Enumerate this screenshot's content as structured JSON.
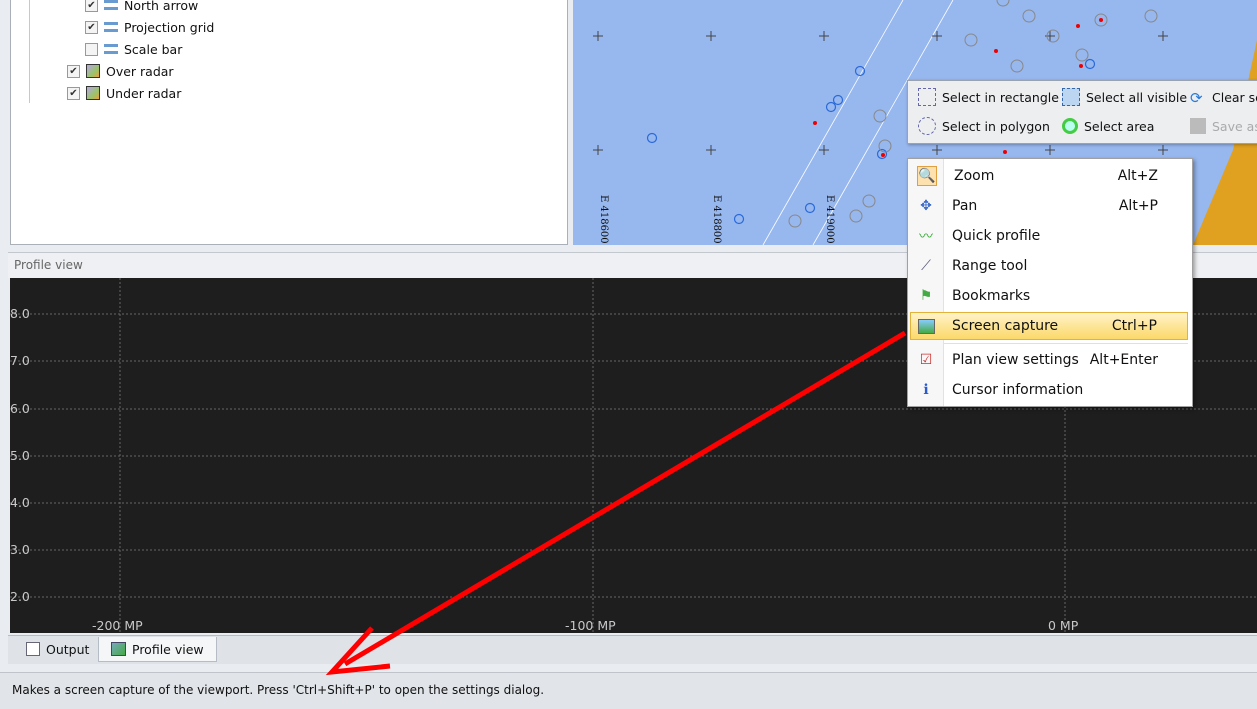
{
  "tree": {
    "items": [
      {
        "label": "North arrow",
        "checked": true
      },
      {
        "label": "Projection grid",
        "checked": true
      },
      {
        "label": "Scale bar",
        "checked": false
      },
      {
        "label": "Over radar",
        "checked": true
      },
      {
        "label": "Under radar",
        "checked": true
      }
    ]
  },
  "map": {
    "grid_labels": [
      "E 418600",
      "E 418800",
      "E 419000"
    ]
  },
  "selection_toolbar": {
    "select_rectangle": "Select in rectangle",
    "select_all_visible": "Select all visible",
    "clear_selection": "Clear se",
    "select_polygon": "Select in polygon",
    "select_area": "Select area",
    "save_as": "Save as"
  },
  "context_menu": {
    "items": [
      {
        "label": "Zoom",
        "shortcut": "Alt+Z"
      },
      {
        "label": "Pan",
        "shortcut": "Alt+P"
      },
      {
        "label": "Quick profile",
        "shortcut": ""
      },
      {
        "label": "Range tool",
        "shortcut": ""
      },
      {
        "label": "Bookmarks",
        "shortcut": ""
      },
      {
        "label": "Screen capture",
        "shortcut": "Ctrl+P"
      },
      {
        "label": "Plan view settings",
        "shortcut": "Alt+Enter"
      },
      {
        "label": "Cursor information",
        "shortcut": ""
      }
    ]
  },
  "profile": {
    "title": "Profile view",
    "y_ticks": [
      "8.0",
      "7.0",
      "6.0",
      "5.0",
      "4.0",
      "3.0",
      "2.0"
    ],
    "x_ticks": [
      "-200 MP",
      "-100 MP",
      "0 MP"
    ]
  },
  "tabs": {
    "output": "Output",
    "profile_view": "Profile view"
  },
  "status": "Makes a screen capture of the viewport. Press 'Ctrl+Shift+P' to open the settings dialog.",
  "colors": {
    "map_bg": "#97b7ef",
    "plot_bg": "#1e1e1e",
    "arrow": "#ff0000",
    "highlight": "#fbd96a"
  }
}
